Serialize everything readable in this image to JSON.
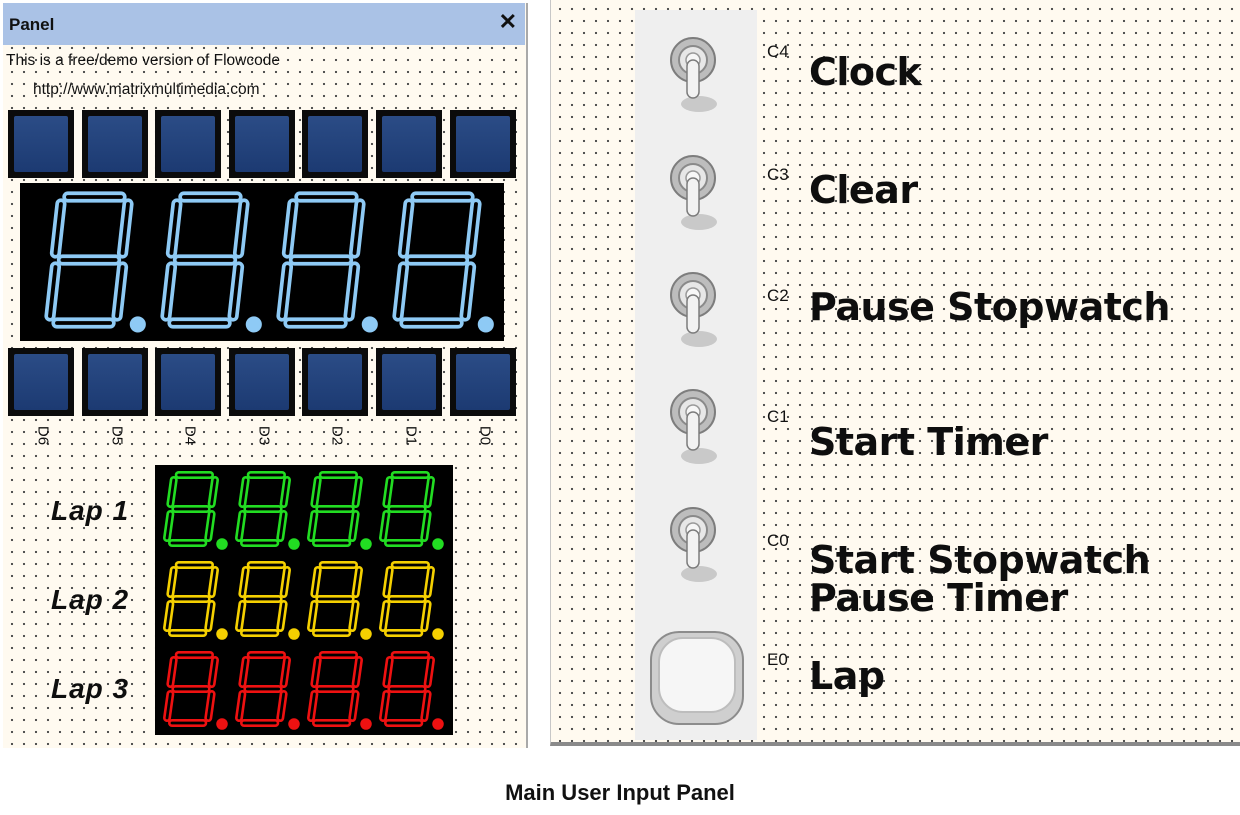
{
  "panel": {
    "title": "Panel",
    "close_glyph": "✕",
    "demo_line_1": "This is a free/demo version of Flowcode",
    "demo_line_2": "http://www.matrixmultimedia.com",
    "top_led_count": 7,
    "bottom_led_count": 7,
    "led_color": "#2b4c86",
    "main_display": {
      "digits": 4,
      "color": "#8ecaf5",
      "state": "unlit"
    },
    "port_labels": [
      "D6",
      "D5",
      "D4",
      "D3",
      "D2",
      "D1",
      "D0"
    ],
    "laps": [
      {
        "label": "Lap 1",
        "color": "#22dd22"
      },
      {
        "label": "Lap 2",
        "color": "#f5d000"
      },
      {
        "label": "Lap 3",
        "color": "#ee1111"
      }
    ]
  },
  "controls": [
    {
      "type": "toggle",
      "io": "C4",
      "label_lines": [
        "Clock"
      ],
      "icon": "toggle-switch-icon"
    },
    {
      "type": "toggle",
      "io": "C3",
      "label_lines": [
        "Clear"
      ],
      "icon": "toggle-switch-icon"
    },
    {
      "type": "toggle",
      "io": "C2",
      "label_lines": [
        "Pause Stopwatch"
      ],
      "icon": "toggle-switch-icon"
    },
    {
      "type": "toggle",
      "io": "C1",
      "label_lines": [
        "Start Timer"
      ],
      "icon": "toggle-switch-icon"
    },
    {
      "type": "toggle",
      "io": "C0",
      "label_lines": [
        "Start Stopwatch",
        "Pause Timer"
      ],
      "icon": "toggle-switch-icon"
    },
    {
      "type": "push-button",
      "io": "E0",
      "label_lines": [
        "Lap"
      ],
      "icon": "push-button-icon"
    }
  ],
  "caption": "Main User Input Panel"
}
